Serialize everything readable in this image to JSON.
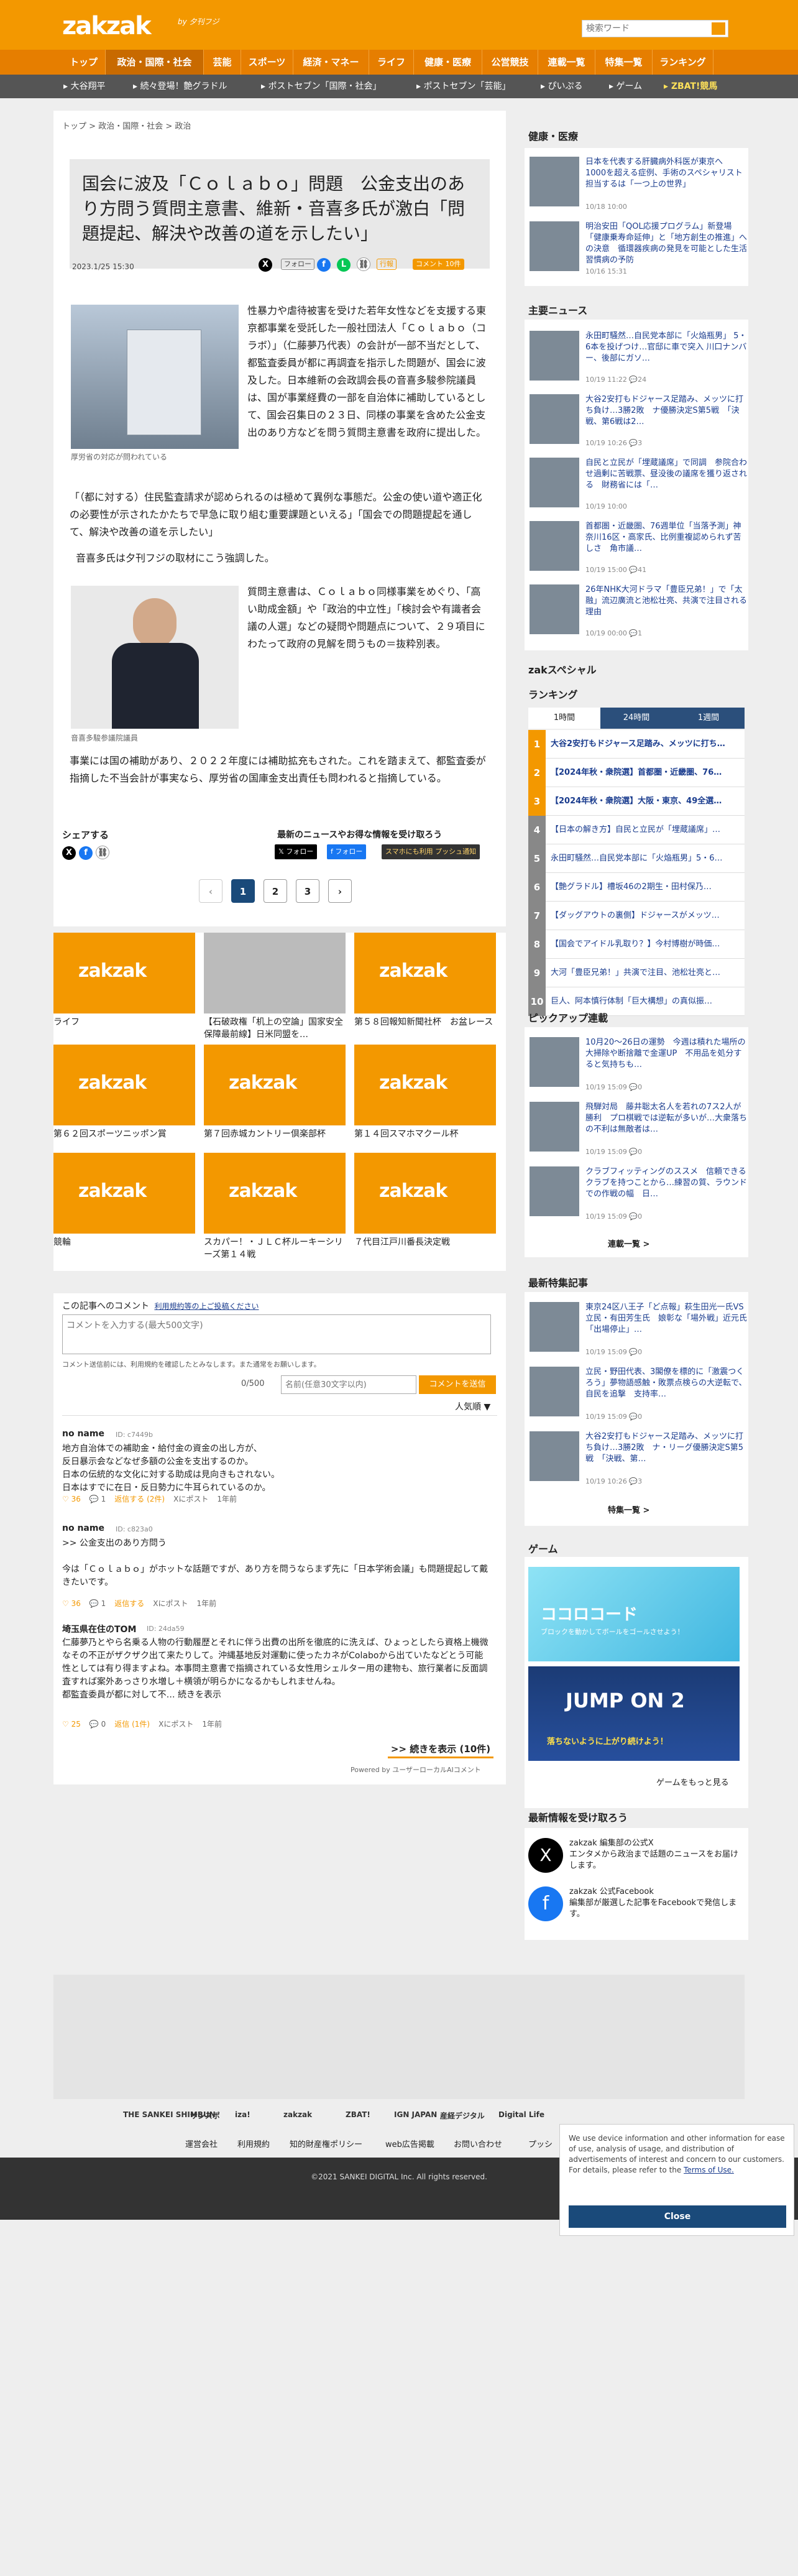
{
  "header": {
    "logo": "zakzak",
    "logo_tag": "by 夕刊フジ",
    "search_placeholder": "検索ワード"
  },
  "nav": [
    "トップ",
    "政治・国際・社会",
    "芸能",
    "スポーツ",
    "経済・マネー",
    "ライフ",
    "健康・医療",
    "公営競技",
    "連載一覧",
    "特集一覧",
    "ランキング"
  ],
  "subnav": [
    "大谷翔平",
    "続々登場！艶グラドル",
    "ポストセブン「国際・社会」",
    "ポストセブン「芸能」",
    "ぴいぷる",
    "ゲーム",
    "ZBAT!競馬"
  ],
  "breadcrumb": [
    "トップ",
    "政治・国際・社会",
    "政治"
  ],
  "article": {
    "title": "国会に波及「Ｃｏｌａｂｏ」問題　公金支出のあり方問う質問主意書、維新・音喜多氏が激白「問題提起、解決や改善の道を示したい」",
    "date": "2023.1/25 15:30",
    "follow": "フォロー",
    "pill1": "行報",
    "pill2": "コメント 10件",
    "p1": "性暴力や虐待被害を受けた若年女性などを支援する東京都事業を受託した一般社団法人「Ｃｏｌａｂｏ（コラボ）」（仁藤夢乃代表）の会計が一部不当だとして、都監査委員が都に再調査を指示した問題が、国会に波及した。日本維新の会政調会長の音喜多駿参院議員は、国が事業経費の一部を自治体に補助しているとして、国会召集日の２３日、同様の事業を含めた公金支出のあり方などを問う質問主意書を政府に提出した。",
    "caption1": "厚労省の対応が問われている",
    "p2": "「（都に対する）住民監査請求が認められるのは極めて異例な事態だ。公金の使い道や適正化の必要性が示されたかたちで早急に取り組む重要課題といえる」「国会での問題提起を通して、解決や改善の道を示したい」",
    "p3": "音喜多氏は夕刊フジの取材にこう強調した。",
    "p4": "質問主意書は、Ｃｏｌａｂｏ同様事業をめぐり、「高い助成金額」や「政治的中立性」「検討会や有識者会議の人選」などの疑問や問題点について、２９項目にわたって政府の見解を問うもの＝抜粋別表。",
    "caption2": "音喜多駿参議院議員",
    "p5": "事業には国の補助があり、２０２２年度には補助拡充もされた。これを踏まえて、都監査委が指摘した不当会計が事実なら、厚労省の国庫金支出責任も問われると指摘している。",
    "share": "シェアする",
    "newsline": "最新のニュースやお得な情報を受け取ろう",
    "follow_x": "フォロー",
    "follow_fb": "フォロー",
    "push": "スマホにも利用 プッシュ通知",
    "pages": [
      "1",
      "2",
      "3"
    ]
  },
  "grid": [
    {
      "caption": "ライフ"
    },
    {
      "caption": "【石破政権「机上の空論」国家安全保障最前線】日米同盟を…"
    },
    {
      "caption": "第５８回報知新聞社杯　お盆レース"
    },
    {
      "caption": "第６２回スポーツニッポン賞"
    },
    {
      "caption": "第７回赤城カントリー倶楽部杯"
    },
    {
      "caption": "第１４回スマホマクール杯"
    },
    {
      "caption": "競輪"
    },
    {
      "caption": "スカパー！・ＪＬＣ杯ルーキーシリーズ第１４戦"
    },
    {
      "caption": "７代目江戸川番長決定戦"
    }
  ],
  "comments": {
    "heading": "この記事へのコメント",
    "policy": "利用規約等の上ご投稿ください",
    "textarea_placeholder": "コメントを入力する(最大500文字)",
    "note": "コメント送信前には、利用規約を確認したとみなします。また通常をお願いします。",
    "count": "0/500",
    "name_placeholder": "名前(任意30文字以内)",
    "submit": "コメントを送信",
    "sort": "人気順 ▼",
    "items": [
      {
        "name": "no name",
        "id": "ID: c7449b",
        "text": "地方自治体での補助金・給付金の資金の出し方が、\n反日暴示会などなぜ多額の公金を支出するのか。\n日本の伝統的な文化に対する助成は見向きもされない。\n日本はすでに在日・反日勢力に牛耳られているのか。",
        "likes": "36",
        "replies": "1",
        "reply": "返信する (2件)",
        "post": "Xにポスト",
        "ago": "1年前"
      },
      {
        "name": "no name",
        "id": "ID: c823a0",
        "text": ">> 公金支出のあり方問う\n\n今は「Ｃｏｌａｂｏ」がホットな話題ですが、あり方を問うならまず先に「日本学術会議」も問題提起して戴きたいです。",
        "likes": "36",
        "replies": "1",
        "reply": "返信する",
        "post": "Xにポスト",
        "ago": "1年前"
      },
      {
        "name": "埼玉県在住のTOM",
        "id": "ID: 24da59",
        "text": "仁藤夢乃とやら名乗る人物の行動履歴とそれに伴う出費の出所を徹底的に洗えば、ひょっとしたら資格上機微なその不正がザクザク出て来たりして。沖縄基地反対運動に使ったカネがColaboから出ていたなどとう可能性としては有り得ますよね。本事問主意書で指摘されている女性用シェルター用の建物も、旅行業者に反面調査すれば案外あっさり水増し＋横領が明らかになるかもしれませんね。\n都監査委員が都に対して不… 続きを表示",
        "likes": "25",
        "replies": "0",
        "reply": "返信 (1件)",
        "post": "Xにポスト",
        "ago": "1年前"
      }
    ],
    "more": ">> 続きを表示 (10件)",
    "powered": "Powered by ユーザーローカルAIコメント"
  },
  "sidebar": {
    "health_title": "健康・医療",
    "health": [
      {
        "text": "日本を代表する肝臓病外科医が東京へ　1000を超える症例、手術のスペシャリスト　担当するは「一つ上の世界」",
        "meta": "10/18 10:00"
      },
      {
        "text": "明治安田「QOL応援プログラム」新登場「健康乗寿命延伸」と「地方創生の推進」への決意　循環器疾病の発見を可能とした生活習慣病の予防",
        "meta": "10/16 15:31"
      }
    ],
    "main_title": "主要ニュース",
    "main": [
      {
        "text": "永田町騒然…自民党本部に「火焔瓶男」 5・6本を投げつけ…官邸に車で突入 川口ナンバー、後部にガソ…",
        "meta": "10/19 11:22 💬24"
      },
      {
        "text": "大谷2安打もドジャース足踏み、メッツに打ち負け…3勝2敗　ナ優勝決定S第5戦　「決戦、第6戦は2…",
        "meta": "10/19 10:26 💬3"
      },
      {
        "text": "自民と立民が「埋蔵議席」で同調　参院合わせ過剰に苦戦票、昼没後の議席を獲り返される　財務省には「…",
        "meta": "10/19 10:00"
      },
      {
        "text": "首都圏・近畿圏、76週単位「当落予測」神奈川16区・高家氏、比例重複認められず苦しさ　角市議…",
        "meta": "10/19 15:00 💬41"
      },
      {
        "text": "26年NHK大河ドラマ「豊臣兄弟！」で「太融」流辺廣流と池松壮亮、共演で注目される理由",
        "meta": "10/19 00:00 💬1"
      }
    ],
    "special_title": "zakスペシャル",
    "ranking_title": "ランキング",
    "rank_tabs": [
      "1時間",
      "24時間",
      "1週間"
    ],
    "ranking": [
      "大谷2安打もドジャース足踏み、メッツに打ち…",
      "【2024年秋・衆院選】首都圏・近畿圏、76…",
      "【2024年秋・衆院選】大阪・東京、49全選…",
      "【日本の解き方】自民と立民が「埋蔵議席」…",
      "永田町騒然…自民党本部に「火焔瓶男」5・6…",
      "【艶グラドル】槽坂46の2期生・田村保乃…",
      "【ダッグアウトの裏側】ドジャースがメッツ…",
      "【国会でアイドル乳取り？】今村博樹が時価…",
      "大河「豊臣兄弟！」共演で注目、池松壮亮と…",
      "巨人、阿本慎行体制「巨大構想」の真似振…"
    ],
    "pickup_title": "ピックアップ連載",
    "pickup": [
      {
        "text": "10月20〜26日の運勢　今週は積れた場所の大掃除や断捨離で金運UP　不用品を処分すると気持ちも…",
        "meta": "10/19 15:09 💬0"
      },
      {
        "text": "飛騨対局　藤井聡太名人を若れの7ス2人が勝利　プロ棋戦では逆転が多いが…大衆落ちの不利は無敵者は…",
        "meta": "10/19 15:09 💬0"
      },
      {
        "text": "クラブフィッティングのススメ　信頼できるクラブを持つことから…練習の質、ラウンドでの作戦の幅　日…",
        "meta": "10/19 15:09 💬0"
      }
    ],
    "pickup_more": "連載一覧 >",
    "feature_title": "最新特集記事",
    "feature": [
      {
        "text": "東京24区八王子「ど点報」萩生田光一氏VS立民・有田芳生氏　娘彰な「場外戦」近元氏「出場停止」…",
        "meta": "10/19 15:09 💬0"
      },
      {
        "text": "立民・野田代表、3閣僚を標的に「激震つくろう」夢物語感触・敗票点検らの大逆転で、自民を追撃　支持率…",
        "meta": "10/19 15:09 💬0"
      },
      {
        "text": "大谷2安打もドジャース足踏み、メッツに打ち負け…3勝2敗　ナ・リーグ優勝決定S第5戦　「決戦、第…",
        "meta": "10/19 10:26 💬3"
      }
    ],
    "feature_more": "特集一覧 >",
    "game_title": "ゲーム",
    "game1": "ココロコード",
    "game1_sub": "ブロックを動かしてボールをゴールさせよう！",
    "game2": "JUMP ON 2",
    "game2_sub": "落ちないように上がり続けよう！",
    "game_more": "ゲームをもっと見る",
    "follow_title": "最新情報を受け取ろう",
    "follow": [
      {
        "title": "zakzak 編集部の公式X",
        "desc": "エンタメから政治まで話題のニュースをお届けします。"
      },
      {
        "title": "zakzak 公式Facebook",
        "desc": "編集部が厳選した記事をFacebookで発信します。"
      }
    ]
  },
  "footer": {
    "logos": [
      "THE SANKEI SHIMBUN",
      "サンスポ",
      "iza!",
      "zakzak",
      "ZBAT!",
      "IGN JAPAN",
      "産経デジタル",
      "Digital Life"
    ],
    "links": [
      "運営会社",
      "利用規約",
      "知的財産権ポリシー",
      "web広告掲載",
      "お問い合わせ",
      "プッシ"
    ],
    "copyright": "©2021 SANKEI DIGITAL Inc. All rights reserved."
  },
  "cookie": {
    "text": "We use device information and other information for ease of use, analysis of usage, and distribution of advertisements of interest and concern to our customers. For details, please refer to the",
    "link": "Terms of Use.",
    "button": "Close"
  },
  "colors": {
    "brand": "#f39800",
    "nav": "#e67e00",
    "link": "#1a3c8e",
    "x": "#000000",
    "facebook": "#1877f2",
    "line": "#06c755"
  }
}
